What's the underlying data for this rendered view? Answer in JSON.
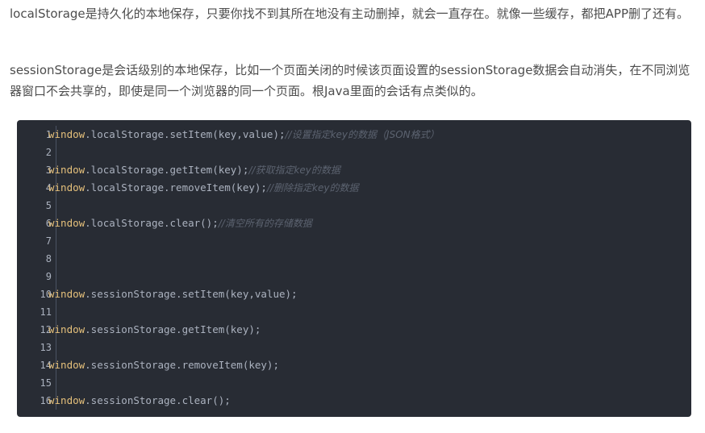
{
  "paragraphs": [
    "localStorage是持久化的本地保存，只要你找不到其所在地没有主动删掉，就会一直存在。就像一些缓存，都把APP删了还有。",
    "sessionStorage是会话级别的本地保存，比如一个页面关闭的时候该页面设置的sessionStorage数据会自动消失，在不同浏览器窗口不会共享的，即使是同一个浏览器的同一个页面。根Java里面的会话有点类似的。"
  ],
  "code": {
    "lines": [
      {
        "num": "1",
        "obj": "window",
        "rest": ".localStorage.setItem(key,value);",
        "comment": "//设置指定key的数据（JSON格式）"
      },
      {
        "num": "2",
        "obj": "",
        "rest": "",
        "comment": ""
      },
      {
        "num": "3",
        "obj": "window",
        "rest": ".localStorage.getItem(key);",
        "comment": "//获取指定key的数据"
      },
      {
        "num": "4",
        "obj": "window",
        "rest": ".localStorage.removeItem(key);",
        "comment": "//删除指定key的数据"
      },
      {
        "num": "5",
        "obj": "",
        "rest": "",
        "comment": ""
      },
      {
        "num": "6",
        "obj": "window",
        "rest": ".localStorage.clear();",
        "comment": "//清空所有的存储数据"
      },
      {
        "num": "7",
        "obj": "",
        "rest": "",
        "comment": ""
      },
      {
        "num": "8",
        "obj": "",
        "rest": "",
        "comment": ""
      },
      {
        "num": "9",
        "obj": "",
        "rest": "",
        "comment": ""
      },
      {
        "num": "10",
        "obj": "window",
        "rest": ".sessionStorage.setItem(key,value);",
        "comment": ""
      },
      {
        "num": "11",
        "obj": "",
        "rest": "",
        "comment": ""
      },
      {
        "num": "12",
        "obj": "window",
        "rest": ".sessionStorage.getItem(key);",
        "comment": ""
      },
      {
        "num": "13",
        "obj": "",
        "rest": "",
        "comment": ""
      },
      {
        "num": "14",
        "obj": "window",
        "rest": ".sessionStorage.removeItem(key);",
        "comment": ""
      },
      {
        "num": "15",
        "obj": "",
        "rest": "",
        "comment": ""
      },
      {
        "num": "16",
        "obj": "window",
        "rest": ".sessionStorage.clear();",
        "comment": ""
      }
    ]
  },
  "colors": {
    "code_bg": "#282c34",
    "keyword": "#e5c07b",
    "comment": "#5c6370",
    "text": "#4d4d4d"
  }
}
